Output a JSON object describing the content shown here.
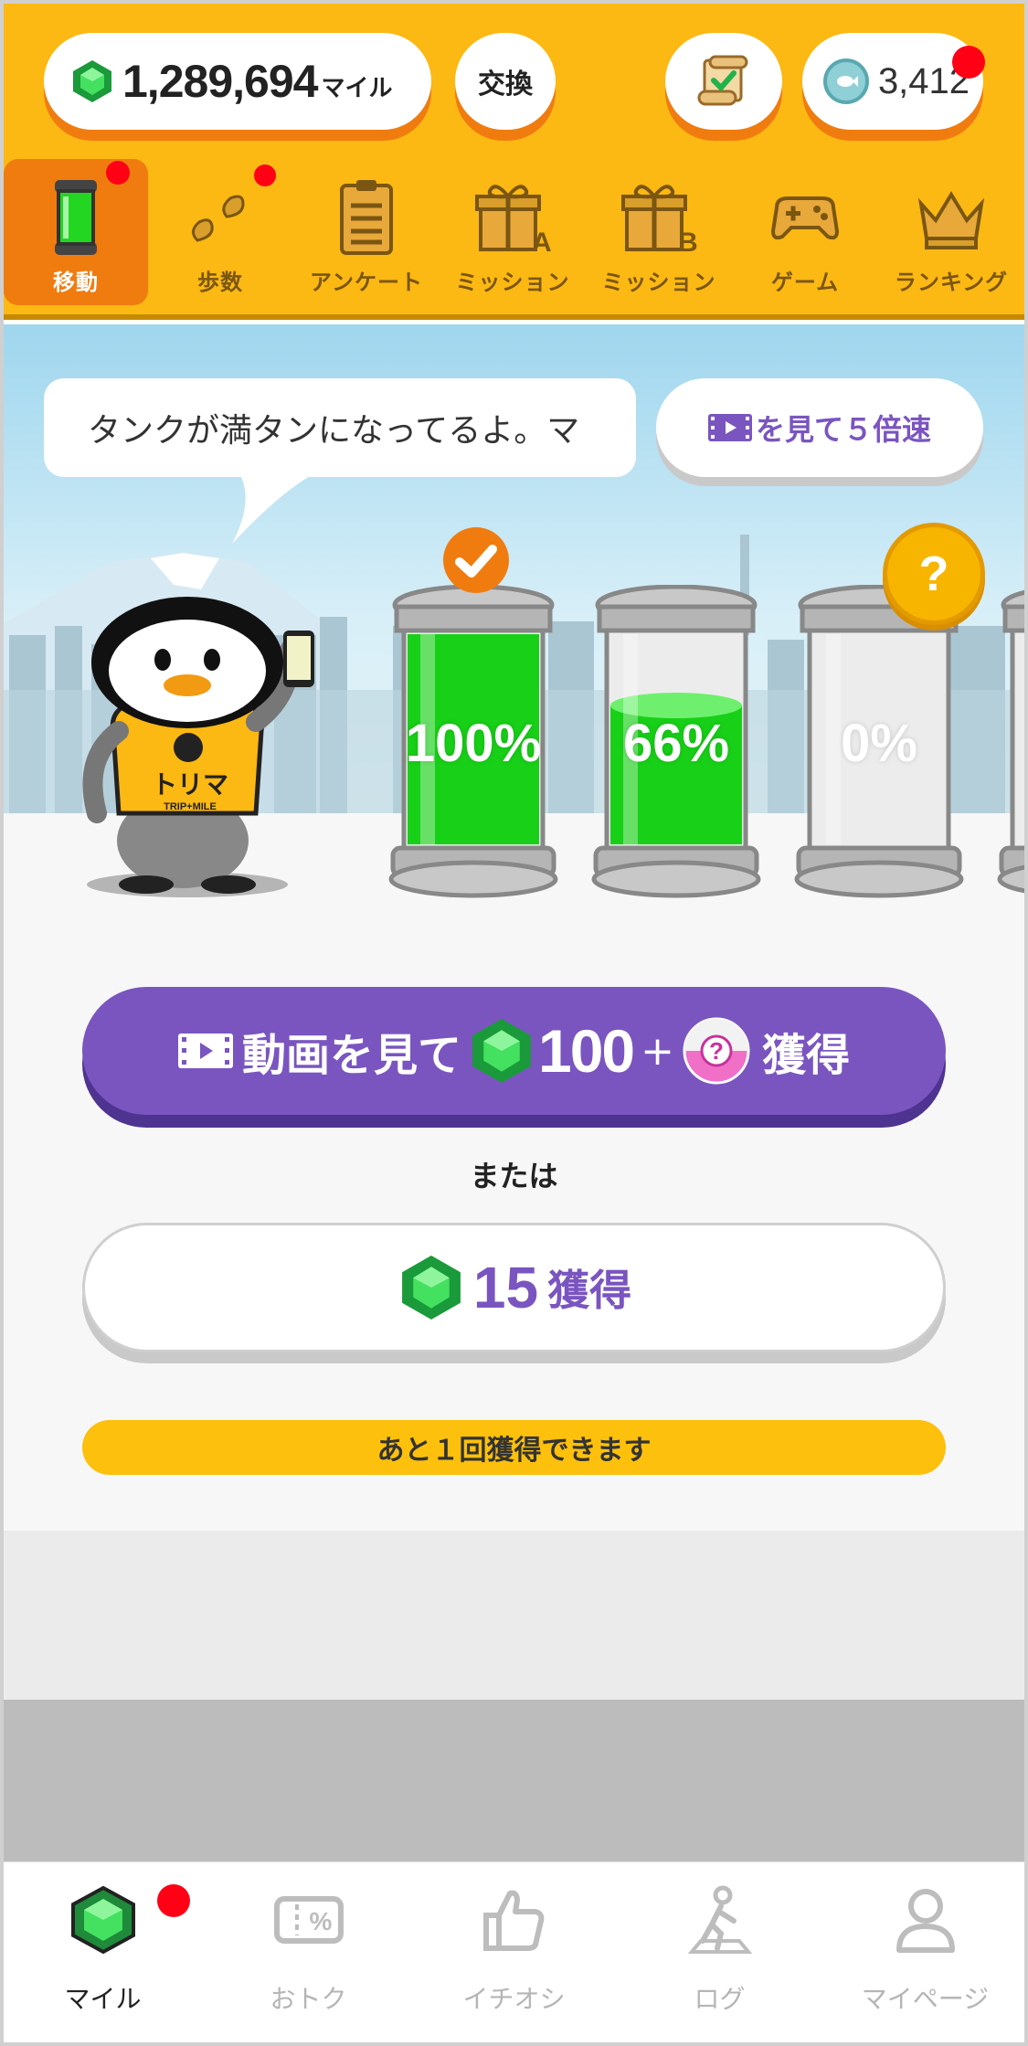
{
  "header": {
    "miles_value": "1,289,694",
    "miles_unit": "マイル",
    "exchange_label": "交換",
    "coins_value": "3,412"
  },
  "tabs": [
    {
      "label": "移動",
      "icon": "tank-icon",
      "active": true,
      "badge": false
    },
    {
      "label": "歩数",
      "icon": "footprints-icon",
      "active": false,
      "badge": true
    },
    {
      "label": "アンケート",
      "icon": "clipboard-icon",
      "active": false,
      "badge": false
    },
    {
      "label": "ミッション",
      "icon": "gift-a-icon",
      "active": false,
      "badge": false
    },
    {
      "label": "ミッション",
      "icon": "gift-b-icon",
      "active": false,
      "badge": false
    },
    {
      "label": "ゲーム",
      "icon": "gamepad-icon",
      "active": false,
      "badge": false
    },
    {
      "label": "ランキング",
      "icon": "crown-icon",
      "active": false,
      "badge": false
    }
  ],
  "scene": {
    "speech": "タンクが満タンになってるよ。マ",
    "boost_label": "を見て５倍速",
    "mascot_shirt": "トリマ",
    "mascot_shirt_sub": "TRIP+MILE",
    "question_badge": "?",
    "tanks": [
      {
        "label": "100%",
        "fill": 1.0,
        "checked": true
      },
      {
        "label": "66%",
        "fill": 0.66,
        "checked": false
      },
      {
        "label": "0%",
        "fill": 0.0,
        "checked": false
      }
    ]
  },
  "actions": {
    "video_prefix": "動画を見て",
    "video_amount": "100",
    "video_plus": "+",
    "video_suffix": "獲得",
    "or_text": "または",
    "earn_amount": "15",
    "earn_suffix": "獲得",
    "remaining": "あと１回獲得できます"
  },
  "bottom_nav": [
    {
      "label": "マイル",
      "icon": "gem-icon",
      "active": true
    },
    {
      "label": "おトク",
      "icon": "coupon-icon",
      "active": false
    },
    {
      "label": "イチオシ",
      "icon": "thumbs-up-icon",
      "active": false
    },
    {
      "label": "ログ",
      "icon": "walker-icon",
      "active": false
    },
    {
      "label": "マイページ",
      "icon": "person-icon",
      "active": false
    }
  ],
  "colors": {
    "header_bg": "#fcb813",
    "accent_orange": "#f07c10",
    "purple": "#7a55c0",
    "tank_green": "#18d018",
    "badge_red": "#ff0015"
  }
}
